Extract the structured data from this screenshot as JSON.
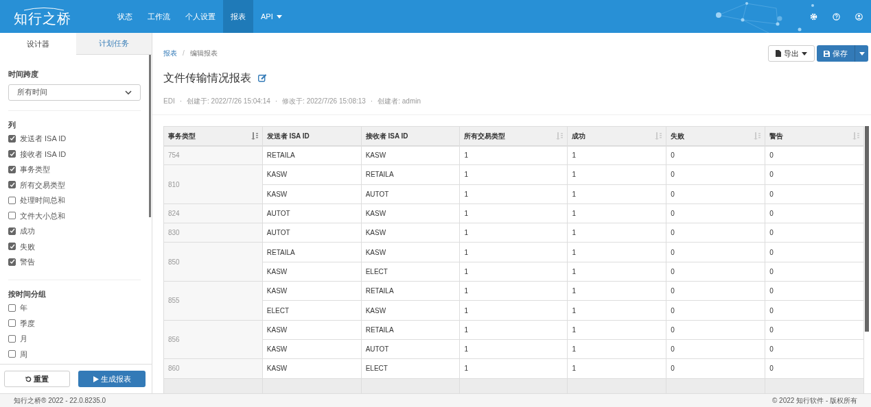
{
  "brand": {
    "name": "知行之桥"
  },
  "nav": [
    {
      "label": "状态",
      "selected": false,
      "dropdown": false
    },
    {
      "label": "工作流",
      "selected": false,
      "dropdown": false
    },
    {
      "label": "个人设置",
      "selected": false,
      "dropdown": false
    },
    {
      "label": "报表",
      "selected": true,
      "dropdown": false
    },
    {
      "label": "API",
      "selected": false,
      "dropdown": true
    }
  ],
  "sidebar": {
    "tabs": [
      {
        "label": "设计器",
        "selected": true
      },
      {
        "label": "计划任务",
        "selected": false
      }
    ],
    "time_span": {
      "label": "时间跨度",
      "value": "所有时间"
    },
    "sections": [
      {
        "title": "列",
        "items": [
          {
            "label": "发送者 ISA ID",
            "checked": true
          },
          {
            "label": "接收者 ISA ID",
            "checked": true
          },
          {
            "label": "事务类型",
            "checked": true
          },
          {
            "label": "所有交易类型",
            "checked": true
          },
          {
            "label": "处理时间总和",
            "checked": false
          },
          {
            "label": "文件大小总和",
            "checked": false
          },
          {
            "label": "成功",
            "checked": true
          },
          {
            "label": "失败",
            "checked": true
          },
          {
            "label": "警告",
            "checked": true
          }
        ]
      },
      {
        "title": "按时间分组",
        "items": [
          {
            "label": "年",
            "checked": false
          },
          {
            "label": "季度",
            "checked": false
          },
          {
            "label": "月",
            "checked": false
          },
          {
            "label": "周",
            "checked": false
          }
        ]
      }
    ],
    "buttons": [
      {
        "label": "重置",
        "kind": "reset"
      },
      {
        "label": "生成报表",
        "kind": "run"
      }
    ]
  },
  "breadcrumb_separator": "/",
  "breadcrumb": [
    {
      "label": "报表",
      "link": true
    },
    {
      "label": "编辑报表",
      "link": false
    }
  ],
  "actions": [
    {
      "label": "导出",
      "kind": "export"
    },
    {
      "label": "保存",
      "kind": "save"
    }
  ],
  "report": {
    "title": "文件传输情况报表",
    "meta_separator": "·",
    "meta": [
      "EDI",
      "创建于: 2022/7/26 15:04:14",
      "修改于: 2022/7/26 15:08:13",
      "创建者: admin"
    ]
  },
  "table": {
    "columns": [
      {
        "label": "事务类型",
        "sortable": true,
        "sorted": true
      },
      {
        "label": "发送者 ISA ID",
        "sortable": false
      },
      {
        "label": "接收者 ISA ID",
        "sortable": false
      },
      {
        "label": "所有交易类型",
        "sortable": true,
        "sorted": false
      },
      {
        "label": "成功",
        "sortable": true,
        "sorted": false
      },
      {
        "label": "失败",
        "sortable": true,
        "sorted": false
      },
      {
        "label": "警告",
        "sortable": true,
        "sorted": false
      }
    ],
    "groups": [
      {
        "type": "754",
        "rows": [
          [
            "RETAILA",
            "KASW",
            "1",
            "1",
            "0",
            "0"
          ]
        ]
      },
      {
        "type": "810",
        "rows": [
          [
            "KASW",
            "RETAILA",
            "1",
            "1",
            "0",
            "0"
          ],
          [
            "KASW",
            "AUTOT",
            "1",
            "1",
            "0",
            "0"
          ]
        ]
      },
      {
        "type": "824",
        "rows": [
          [
            "AUTOT",
            "KASW",
            "1",
            "1",
            "0",
            "0"
          ]
        ]
      },
      {
        "type": "830",
        "rows": [
          [
            "AUTOT",
            "KASW",
            "1",
            "1",
            "0",
            "0"
          ]
        ]
      },
      {
        "type": "850",
        "rows": [
          [
            "RETAILA",
            "KASW",
            "1",
            "1",
            "0",
            "0"
          ],
          [
            "KASW",
            "ELECT",
            "1",
            "1",
            "0",
            "0"
          ]
        ]
      },
      {
        "type": "855",
        "rows": [
          [
            "KASW",
            "RETAILA",
            "1",
            "1",
            "0",
            "0"
          ],
          [
            "ELECT",
            "KASW",
            "1",
            "1",
            "0",
            "0"
          ]
        ]
      },
      {
        "type": "856",
        "rows": [
          [
            "KASW",
            "RETAILA",
            "1",
            "1",
            "0",
            "0"
          ],
          [
            "KASW",
            "AUTOT",
            "1",
            "1",
            "0",
            "0"
          ]
        ]
      },
      {
        "type": "860",
        "rows": [
          [
            "KASW",
            "ELECT",
            "1",
            "1",
            "0",
            "0"
          ]
        ]
      }
    ]
  },
  "footer": {
    "version": "知行之桥® 2022 - 22.0.8235.0",
    "copyright": "© 2022 知行软件 - 版权所有"
  }
}
